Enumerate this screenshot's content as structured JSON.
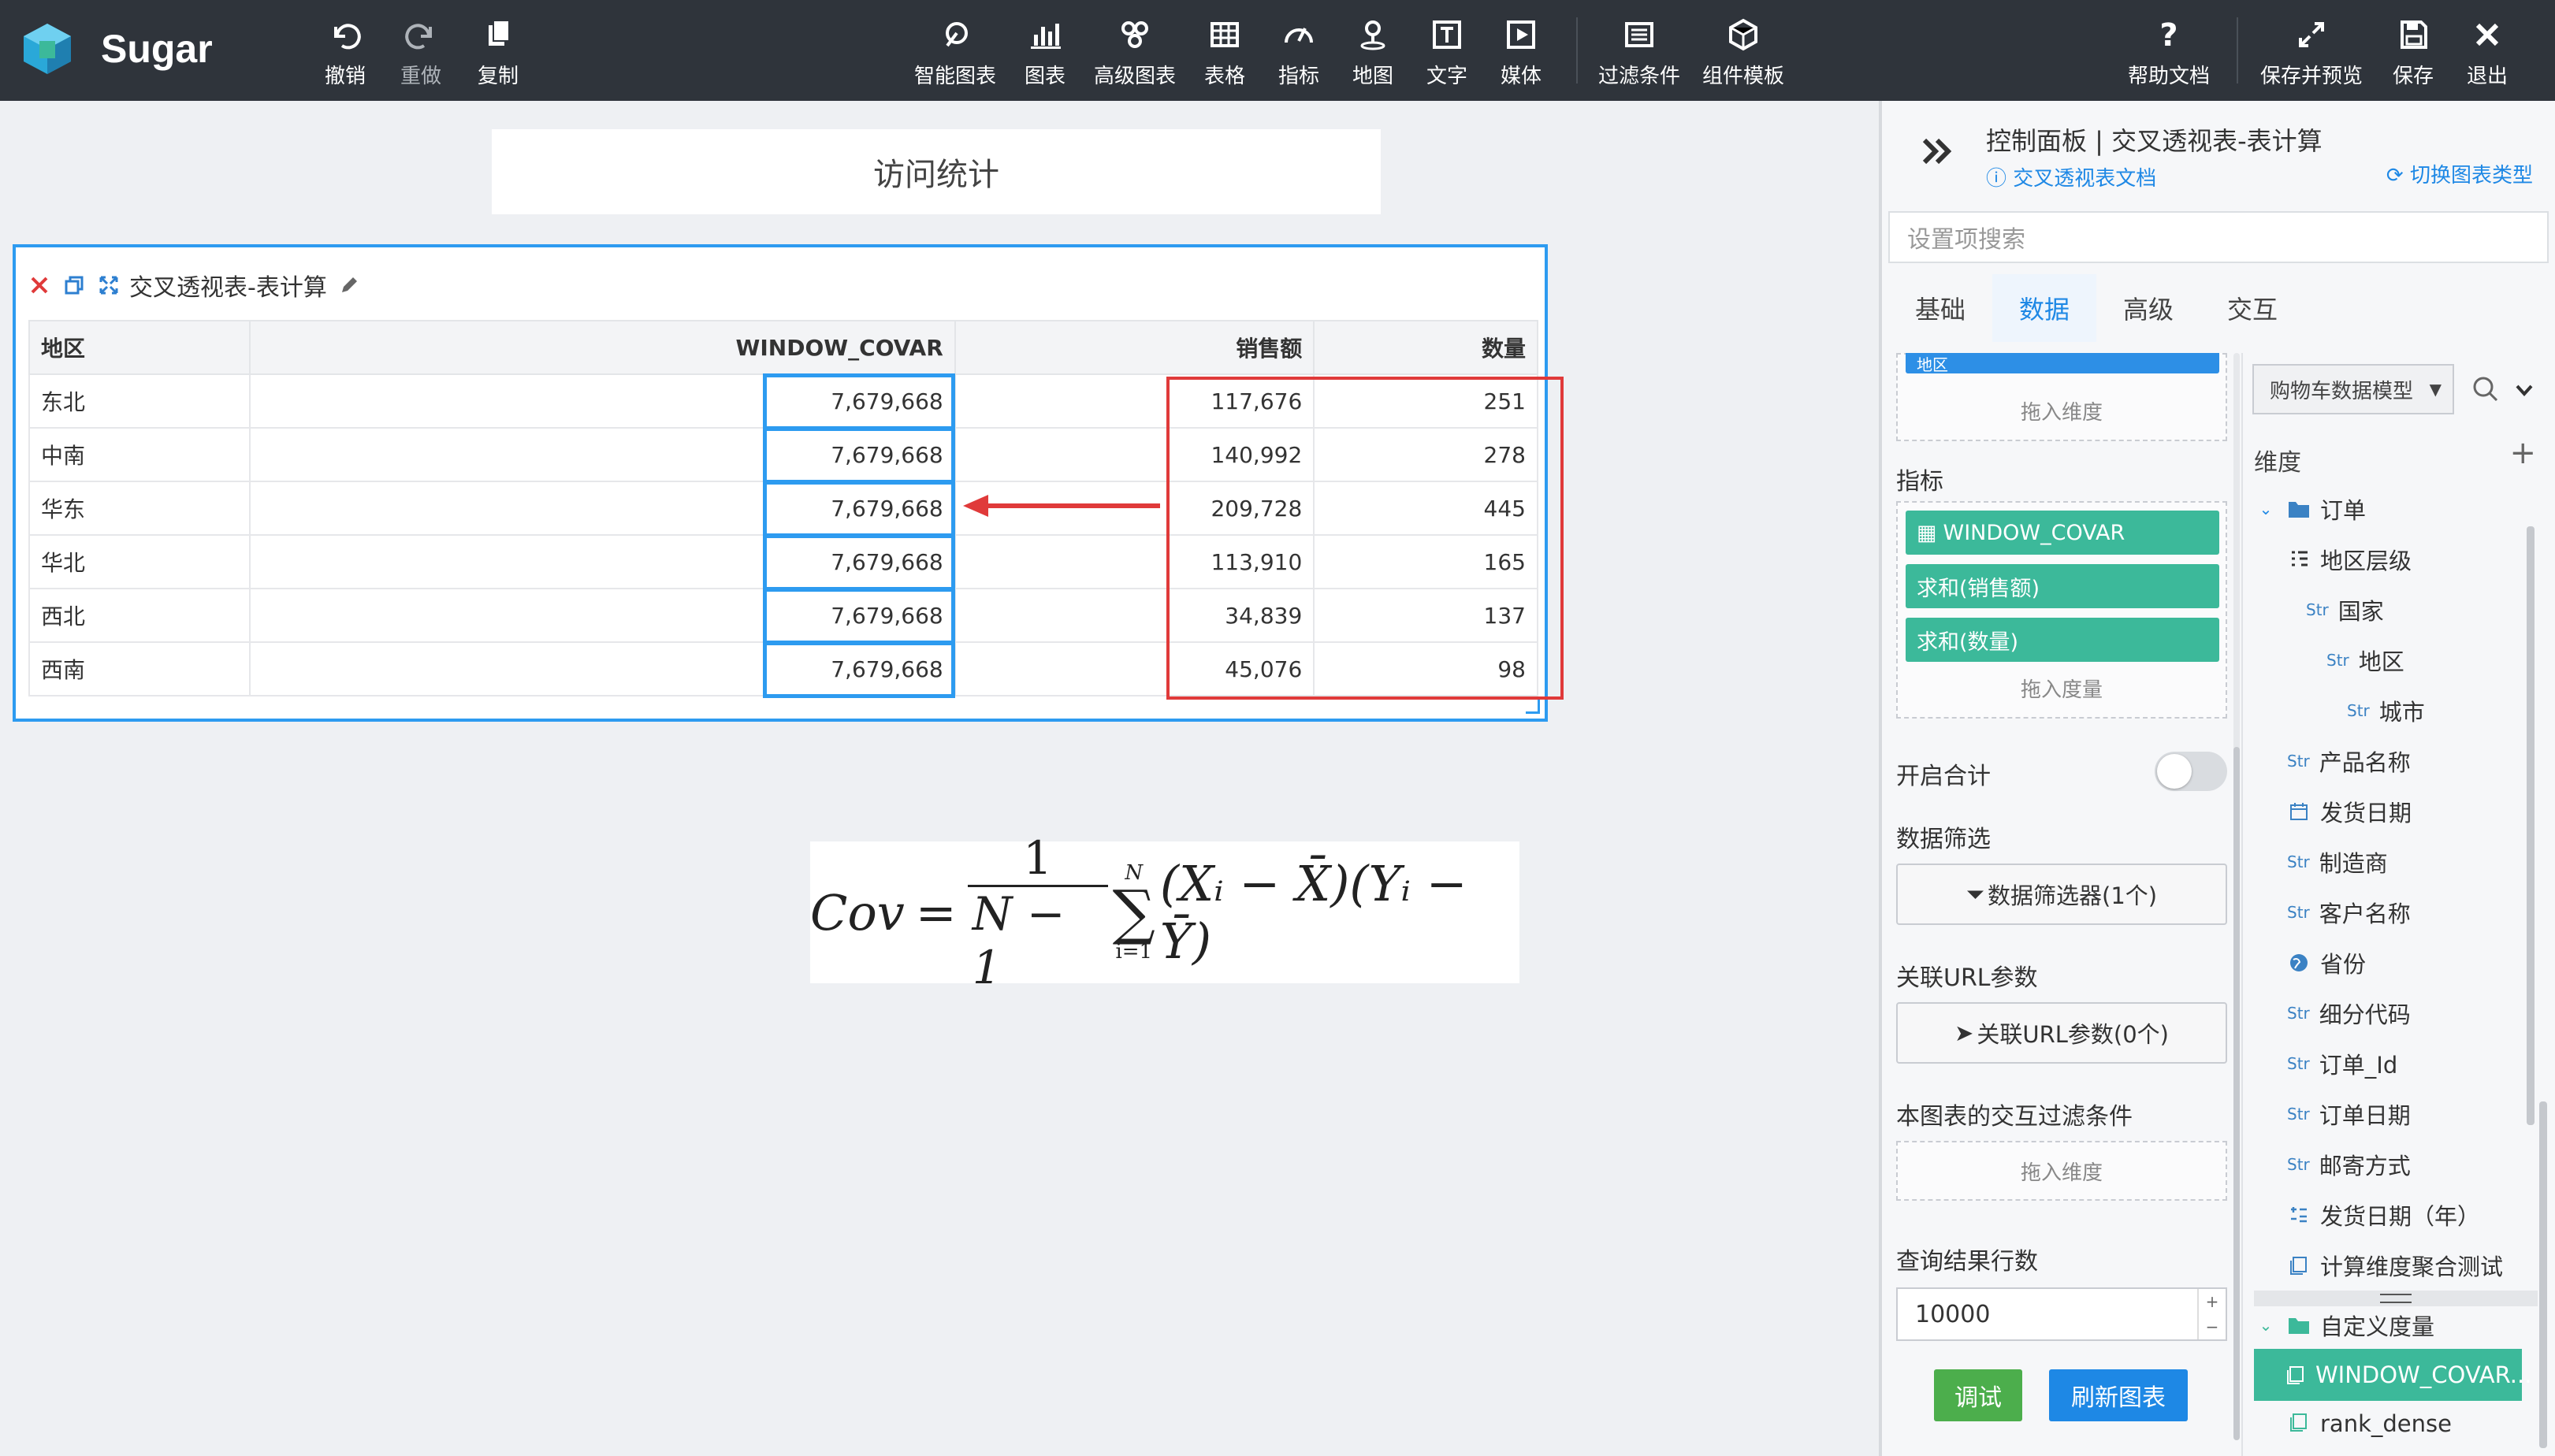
{
  "app": {
    "name": "Sugar"
  },
  "toolbar": {
    "undo": "撤销",
    "redo": "重做",
    "copy": "复制",
    "smart_chart": "智能图表",
    "chart": "图表",
    "advanced_chart": "高级图表",
    "table": "表格",
    "indicator": "指标",
    "map": "地图",
    "text": "文字",
    "media": "媒体",
    "filter": "过滤条件",
    "component_template": "组件模板",
    "help": "帮助文档",
    "save_preview": "保存并预览",
    "save": "保存",
    "exit": "退出"
  },
  "canvas": {
    "page_title": "访问统计",
    "widget_title": "交叉透视表-表计算",
    "table": {
      "columns": [
        "地区",
        "WINDOW_COVAR",
        "销售额",
        "数量"
      ],
      "rows": [
        [
          "东北",
          "7,679,668",
          "117,676",
          "251"
        ],
        [
          "中南",
          "7,679,668",
          "140,992",
          "278"
        ],
        [
          "华东",
          "7,679,668",
          "209,728",
          "445"
        ],
        [
          "华北",
          "7,679,668",
          "113,910",
          "165"
        ],
        [
          "西北",
          "7,679,668",
          "34,839",
          "137"
        ],
        [
          "西南",
          "7,679,668",
          "45,076",
          "98"
        ]
      ]
    },
    "formula": {
      "lhs": "Cov",
      "num": "1",
      "den": "N − 1",
      "sum_top": "N",
      "sum_bottom": "i=1",
      "body": "(Xᵢ − X̄)(Yᵢ − Ȳ)"
    }
  },
  "panel": {
    "title": "控制面板 | 交叉透视表-表计算",
    "doc_link": "交叉透视表文档",
    "switch_link": "切换图表类型",
    "search_placeholder": "设置项搜索",
    "tabs": [
      "基础",
      "数据",
      "高级",
      "交互"
    ],
    "active_tab": "数据",
    "dim_chip_partial": "地区",
    "drop_dimension": "拖入维度",
    "metrics_label": "指标",
    "metrics": [
      "WINDOW_COVAR",
      "求和(销售额)",
      "求和(数量)"
    ],
    "drop_measure": "拖入度量",
    "total_label": "开启合计",
    "total_enabled": false,
    "filter_label": "数据筛选",
    "filter_button": "数据筛选器(1个)",
    "url_label": "关联URL参数",
    "url_button": "关联URL参数(0个)",
    "interactive_label": "本图表的交互过滤条件",
    "drop_dimension_2": "拖入维度",
    "rows_label": "查询结果行数",
    "rows_value": "10000",
    "debug_button": "调试",
    "refresh_button": "刷新图表",
    "model_select": "购物车数据模型",
    "dimension_header": "维度",
    "tree": {
      "order_folder": "订单",
      "region_hierarchy": "地区层级",
      "country": "国家",
      "region": "地区",
      "city": "城市",
      "product_name": "产品名称",
      "ship_date": "发货日期",
      "manufacturer": "制造商",
      "customer_name": "客户名称",
      "province": "省份",
      "segment_code": "细分代码",
      "order_id": "订单_Id",
      "order_date": "订单日期",
      "ship_mode": "邮寄方式",
      "ship_year": "发货日期（年）",
      "calc_dim": "计算维度聚合测试",
      "custom_measure_folder": "自定义度量",
      "custom_measure_selected": "WINDOW_COVAR...",
      "custom_measure_next": "rank_dense"
    },
    "str_tag": "Str"
  },
  "colors": {
    "accent": "#1e88e5",
    "chip": "#3cb99a",
    "highlight_blue": "#2d9bf0",
    "highlight_red": "#e03a3a",
    "topbar": "#2f343b"
  }
}
